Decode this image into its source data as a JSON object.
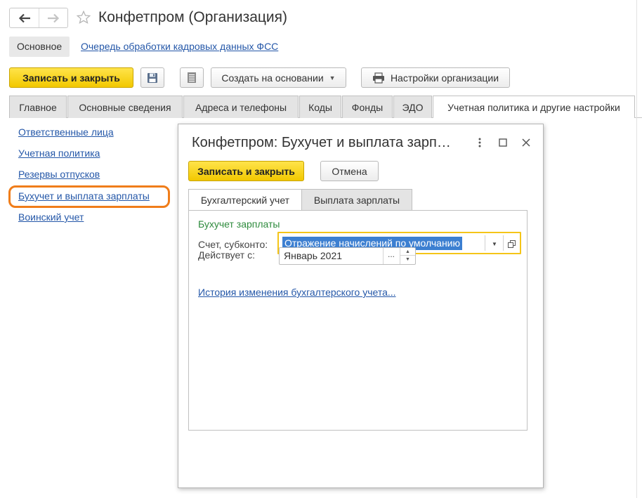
{
  "window": {
    "title": "Конфетпром (Организация)"
  },
  "topbar": {
    "main_label": "Основное",
    "fss_link": "Очередь обработки кадровых данных ФСС"
  },
  "toolbar": {
    "save_close": "Записать и закрыть",
    "create_based": "Создать на основании",
    "org_settings": "Настройки организации"
  },
  "tabs": [
    {
      "label": "Главное"
    },
    {
      "label": "Основные сведения"
    },
    {
      "label": "Адреса и телефоны"
    },
    {
      "label": "Коды"
    },
    {
      "label": "Фонды"
    },
    {
      "label": "ЭДО"
    },
    {
      "label": "Учетная политика и другие настройки",
      "active": true
    }
  ],
  "sidebar": {
    "items": [
      {
        "label": "Ответственные лица"
      },
      {
        "label": "Учетная политика"
      },
      {
        "label": "Резервы отпусков"
      },
      {
        "label": "Бухучет и выплата зарплаты",
        "highlighted": true
      },
      {
        "label": "Воинский учет"
      }
    ]
  },
  "dialog": {
    "title": "Конфетпром: Бухучет и выплата зарп…",
    "save_close": "Записать и закрыть",
    "cancel": "Отмена",
    "tabs": [
      {
        "label": "Бухгалтерский учет",
        "active": true
      },
      {
        "label": "Выплата зарплаты"
      }
    ],
    "group_label": "Бухучет зарплаты",
    "account_label": "Счет, субконто:",
    "account_value": "Отражение начислений по умолчанию",
    "valid_from_label": "Действует с:",
    "valid_from_value": "Январь 2021",
    "date_dots": "...",
    "history_link": "История изменения бухгалтерского учета..."
  },
  "colors": {
    "primary_button": "#f5cf1a",
    "link": "#2457a8",
    "group_label": "#2e8b3d",
    "highlight_ring": "#f07d1a",
    "focus_border": "#f5c518",
    "selection": "#3c7fd1"
  }
}
